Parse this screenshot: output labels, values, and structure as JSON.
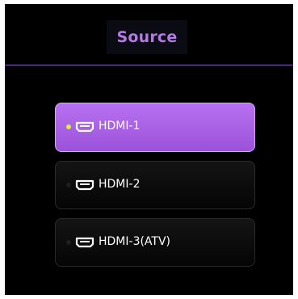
{
  "header": {
    "title": "Source"
  },
  "sources": [
    {
      "label": "HDMI-1",
      "icon": "hdmi-icon",
      "active": true
    },
    {
      "label": "HDMI-2",
      "icon": "hdmi-icon",
      "active": false
    },
    {
      "label": "HDMI-3(ATV)",
      "icon": "hdmi-icon",
      "active": false
    }
  ],
  "colors": {
    "accent": "#b67ae6",
    "active_item": "#a75ee0",
    "active_indicator": "#d4f03a",
    "background": "#000000"
  }
}
